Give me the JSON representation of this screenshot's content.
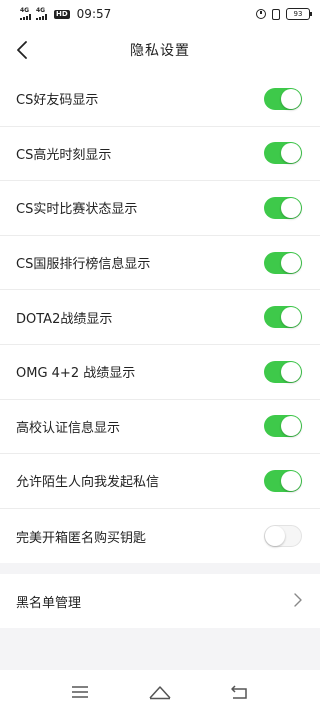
{
  "status_bar": {
    "network_1": "4G",
    "network_2": "4G",
    "hd_badge": "HD",
    "time": "09:57",
    "battery": "93",
    "icons": [
      "alarm-icon",
      "vibrate-icon",
      "battery-icon"
    ]
  },
  "header": {
    "title": "隐私设置",
    "back_icon": "back-arrow-icon"
  },
  "settings": [
    {
      "label": "CS好友码显示",
      "enabled": true
    },
    {
      "label": "CS高光时刻显示",
      "enabled": true
    },
    {
      "label": "CS实时比赛状态显示",
      "enabled": true
    },
    {
      "label": "CS国服排行榜信息显示",
      "enabled": true
    },
    {
      "label": "DOTA2战绩显示",
      "enabled": true
    },
    {
      "label": "OMG 4+2 战绩显示",
      "enabled": true
    },
    {
      "label": "高校认证信息显示",
      "enabled": true
    },
    {
      "label": "允许陌生人向我发起私信",
      "enabled": true
    },
    {
      "label": "完美开箱匿名购买钥匙",
      "enabled": false
    }
  ],
  "blacklist": {
    "label": "黑名单管理",
    "icon": "chevron-right-icon"
  },
  "navbar": {
    "icons": [
      "menu-icon",
      "home-icon",
      "back-icon"
    ]
  },
  "colors": {
    "toggle_on": "#3ec94a",
    "background": "#f4f4f6"
  }
}
